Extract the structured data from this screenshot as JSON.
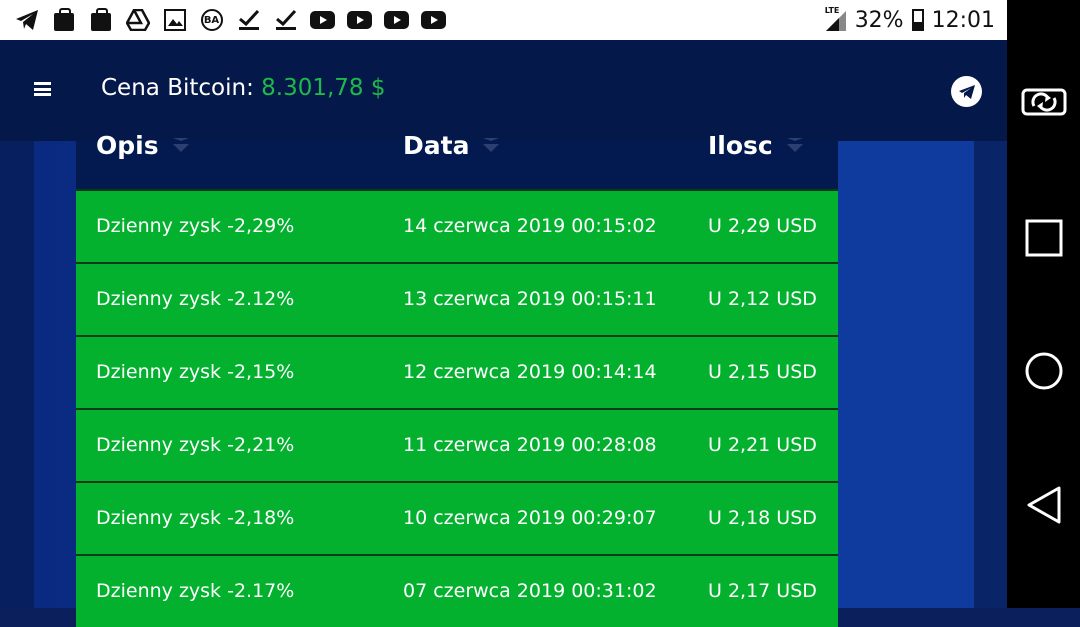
{
  "status_bar": {
    "icons": [
      "telegram-icon",
      "shopping-bag-icon",
      "shopping-bag-icon",
      "google-drive-icon",
      "gallery-icon",
      "ba-icon",
      "check-icon",
      "check-icon",
      "youtube-icon",
      "youtube-icon",
      "youtube-icon",
      "youtube-icon"
    ],
    "network": "LTE",
    "battery": "32%",
    "time": "12:01"
  },
  "header": {
    "price_label": "Cena Bitcoin:",
    "price_value": "8.301,78 $",
    "price_color": "#1fb84a"
  },
  "table": {
    "columns": [
      "Opis",
      "Data",
      "Ilosc"
    ],
    "rows": [
      {
        "opis": "Dzienny zysk -2,29%",
        "data": "14 czerwca 2019 00:15:02",
        "ilosc": "U 2,29 USD"
      },
      {
        "opis": "Dzienny zysk -2.12%",
        "data": "13 czerwca 2019 00:15:11",
        "ilosc": "U 2,12 USD"
      },
      {
        "opis": "Dzienny zysk -2,15%",
        "data": "12 czerwca 2019 00:14:14",
        "ilosc": "U 2,15 USD"
      },
      {
        "opis": "Dzienny zysk -2,21%",
        "data": "11 czerwca 2019 00:28:08",
        "ilosc": "U 2,21 USD"
      },
      {
        "opis": "Dzienny zysk -2,18%",
        "data": "10 czerwca 2019 00:29:07",
        "ilosc": "U 2,18 USD"
      },
      {
        "opis": "Dzienny zysk -2.17%",
        "data": "07 czerwca 2019 00:31:02",
        "ilosc": "U 2,17 USD"
      }
    ],
    "row_color": "#03b12f"
  },
  "nav": [
    "rotate-icon",
    "recents-icon",
    "home-icon",
    "back-icon"
  ]
}
